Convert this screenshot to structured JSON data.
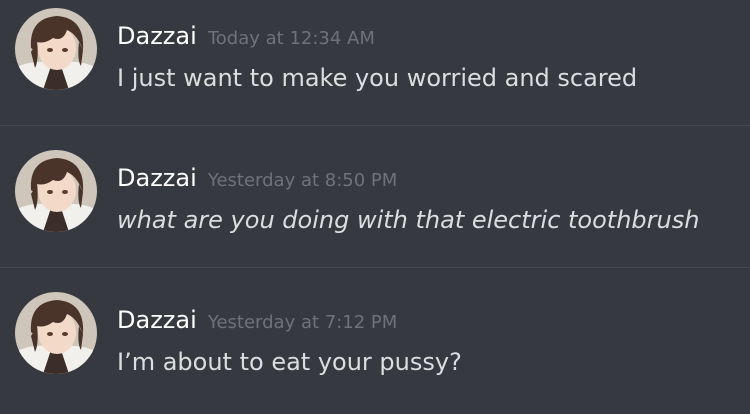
{
  "messages": [
    {
      "username": "Dazzai",
      "timestamp": "Today at 12:34 AM",
      "text": "I just want to make you worried and scared",
      "italic": false
    },
    {
      "username": "Dazzai",
      "timestamp": "Yesterday at 8:50 PM",
      "text": "what are you doing with that electric toothbrush",
      "italic": true
    },
    {
      "username": "Dazzai",
      "timestamp": "Yesterday at 7:12 PM",
      "text": "I’m about to eat your pussy?",
      "italic": false
    }
  ],
  "colors": {
    "background": "#36393f",
    "username": "#ffffff",
    "timestamp": "#6f7279",
    "message_text": "#dcddde",
    "divider": "#45484e"
  },
  "icons": {
    "avatar": "user-avatar"
  }
}
